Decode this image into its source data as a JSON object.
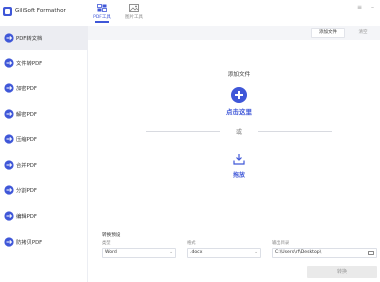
{
  "app": {
    "title": "GiliSoft Formathor"
  },
  "topnav": {
    "items": [
      {
        "label": "PDF工具",
        "active": true,
        "icon": "pdf-tools-icon"
      },
      {
        "label": "图片工具",
        "active": false,
        "icon": "image-tools-icon"
      }
    ]
  },
  "window_controls": {
    "menu": "≡",
    "minimize": "–"
  },
  "sidebar": {
    "items": [
      {
        "label": "PDF转文档",
        "active": true
      },
      {
        "label": "文件转PDF",
        "active": false
      },
      {
        "label": "加密PDF",
        "active": false
      },
      {
        "label": "解密PDF",
        "active": false
      },
      {
        "label": "压缩PDF",
        "active": false
      },
      {
        "label": "合并PDF",
        "active": false
      },
      {
        "label": "分割PDF",
        "active": false
      },
      {
        "label": "编辑PDF",
        "active": false
      },
      {
        "label": "防拷贝PDF",
        "active": false
      }
    ]
  },
  "toolbar": {
    "add_file": "添加文件",
    "clear": "清空"
  },
  "drop_zone": {
    "add_file_label": "添加文件",
    "click_here": "点击这里",
    "or": "或",
    "drag": "拖放"
  },
  "output": {
    "title": "转换预设",
    "type_label": "类型",
    "type_value": "Word",
    "format_label": "格式",
    "format_value": ".docx",
    "folder_label": "输出目录",
    "folder_value": "C:\\Users\\rf\\Desktop\\",
    "convert": "转换"
  },
  "colors": {
    "accent": "#3f57d8",
    "sidebar_active": "#ecedf2"
  }
}
